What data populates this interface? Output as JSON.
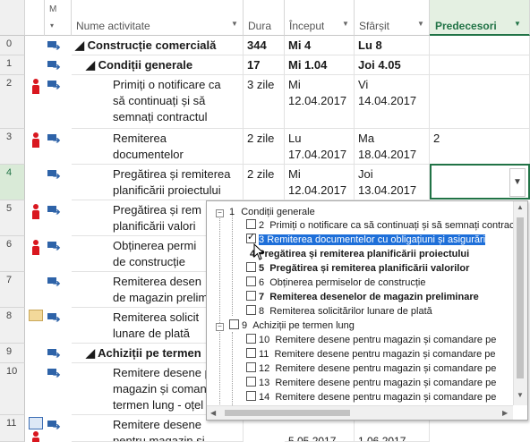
{
  "header": {
    "info": "i",
    "mode": "M",
    "name": "Nume activitate",
    "duration": "Dura",
    "start": "Început",
    "finish": "Sfârșit",
    "predecessors": "Predecesori"
  },
  "rows": [
    {
      "num": "0",
      "name": "◢ Construcție comercială",
      "dur": "344 de",
      "start": "Mi 4",
      "finish": "Lu 8",
      "pred": ""
    },
    {
      "num": "1",
      "name": "◢ Condiții generale",
      "dur": "17 zile",
      "start": "Mi 1.04",
      "finish": "Joi 4.05",
      "pred": ""
    },
    {
      "num": "2",
      "name": "Primiți o notificare ca\nsă continuați și să\nsemnați contractul",
      "dur": "3 zile",
      "start": "Mi\n12.04.2017",
      "finish": "Vi\n14.04.2017",
      "pred": ""
    },
    {
      "num": "3",
      "name": "Remiterea documentelor\ncu obligațiuni și asigurări",
      "dur": "2 zile",
      "start": "Lu\n17.04.2017",
      "finish": "Ma\n18.04.2017",
      "pred": "2"
    },
    {
      "num": "4",
      "name": "Pregătirea și remiterea\nplanificării proiectului",
      "dur": "2 zile",
      "start": "Mi\n12.04.2017",
      "finish": "Joi\n13.04.2017",
      "pred": ""
    },
    {
      "num": "5",
      "name": "Pregătirea și rem\nplanificării valori",
      "dur": "",
      "start": "",
      "finish": "",
      "pred": ""
    },
    {
      "num": "6",
      "name": "Obținerea permi\nde construcție",
      "dur": "",
      "start": "",
      "finish": "",
      "pred": ""
    },
    {
      "num": "7",
      "name": "Remiterea desen\nde magazin prelim",
      "dur": "",
      "start": "",
      "finish": "",
      "pred": ""
    },
    {
      "num": "8",
      "name": "Remiterea solicit\nlunare de plată",
      "dur": "",
      "start": "",
      "finish": "",
      "pred": ""
    },
    {
      "num": "9",
      "name": "◢ Achiziții pe termen",
      "dur": "",
      "start": "",
      "finish": "",
      "pred": ""
    },
    {
      "num": "10",
      "name": "Remitere desene p\nmagazin și comand\ntermen lung - oțel",
      "dur": "",
      "start": "",
      "finish": "",
      "pred": ""
    },
    {
      "num": "11",
      "name": "Remitere desene\npentru magazin și comandare",
      "dur": "",
      "start": "5.05.2017",
      "finish": "1.06.2017",
      "pred": ""
    }
  ],
  "popup": {
    "items": [
      {
        "id": "1",
        "label": "Condiții generale",
        "bold": false,
        "checkbox": false,
        "checked": false,
        "highlight": false
      },
      {
        "id": "2",
        "label": "Primiți o notificare ca să continuați și să semnați contractul",
        "bold": false,
        "checkbox": true,
        "checked": false,
        "highlight": false
      },
      {
        "id": "3",
        "label": "Remiterea documentelor cu obligațiuni și asigurări",
        "bold": false,
        "checkbox": true,
        "checked": true,
        "highlight": true
      },
      {
        "id": "4",
        "label": "Pregătirea și remiterea planificării proiectului",
        "bold": true,
        "checkbox": false,
        "checked": false,
        "highlight": false
      },
      {
        "id": "5",
        "label": "Pregătirea și remiterea planificării valorilor",
        "bold": true,
        "checkbox": true,
        "checked": false,
        "highlight": false
      },
      {
        "id": "6",
        "label": "Obținerea permiselor de construcție",
        "bold": false,
        "checkbox": true,
        "checked": false,
        "highlight": false
      },
      {
        "id": "7",
        "label": "Remiterea desenelor de magazin preliminare",
        "bold": true,
        "checkbox": true,
        "checked": false,
        "highlight": false
      },
      {
        "id": "8",
        "label": "Remiterea solicitărilor lunare de plată",
        "bold": false,
        "checkbox": true,
        "checked": false,
        "highlight": false
      },
      {
        "id": "9",
        "label": "Achiziții pe termen lung",
        "bold": false,
        "checkbox": true,
        "checked": false,
        "highlight": false
      },
      {
        "id": "10",
        "label": "Remitere desene pentru magazin și comandare pe",
        "bold": false,
        "checkbox": true,
        "checked": false,
        "highlight": false
      },
      {
        "id": "11",
        "label": "Remitere desene pentru magazin și comandare pe",
        "bold": false,
        "checkbox": true,
        "checked": false,
        "highlight": false
      },
      {
        "id": "12",
        "label": "Remitere desene pentru magazin și comandare pe",
        "bold": false,
        "checkbox": true,
        "checked": false,
        "highlight": false
      },
      {
        "id": "13",
        "label": "Remitere desene pentru magazin și comandare pe",
        "bold": false,
        "checkbox": true,
        "checked": false,
        "highlight": false
      },
      {
        "id": "14",
        "label": "Remitere desene pentru magazin și comandare pe",
        "bold": false,
        "checkbox": true,
        "checked": false,
        "highlight": false
      }
    ]
  },
  "colors": {
    "accent": "#217346",
    "selection": "#1e6fd9",
    "resource": "#d9171f",
    "task_mode": "#2e63a8"
  },
  "icons": [
    "info-icon",
    "task-mode-icon",
    "resource-person-icon",
    "note-icon",
    "calendar-icon",
    "dropdown-arrow-icon",
    "expand-icon",
    "collapse-icon"
  ]
}
